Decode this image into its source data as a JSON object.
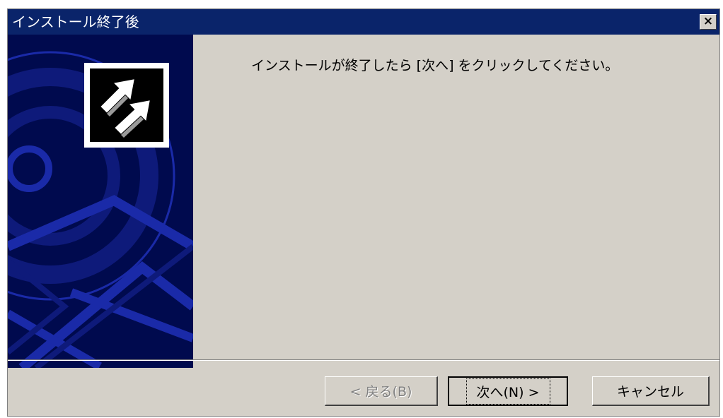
{
  "window": {
    "title": "インストール終了後",
    "close_label": "×"
  },
  "main": {
    "message": "インストールが終了したら [次へ] をクリックしてください。"
  },
  "buttons": {
    "back_label": "< 戻る(B)",
    "next_label": "次へ(N) >",
    "cancel_label": "キャンセル"
  },
  "colors": {
    "titlebar": "#0a246a",
    "panel_background": "#000a4e",
    "panel_graphic": "#1a2aa8",
    "dialog_face": "#d4d0c8"
  },
  "icons": {
    "logo": "install-arrow-icon",
    "close": "close-icon"
  }
}
